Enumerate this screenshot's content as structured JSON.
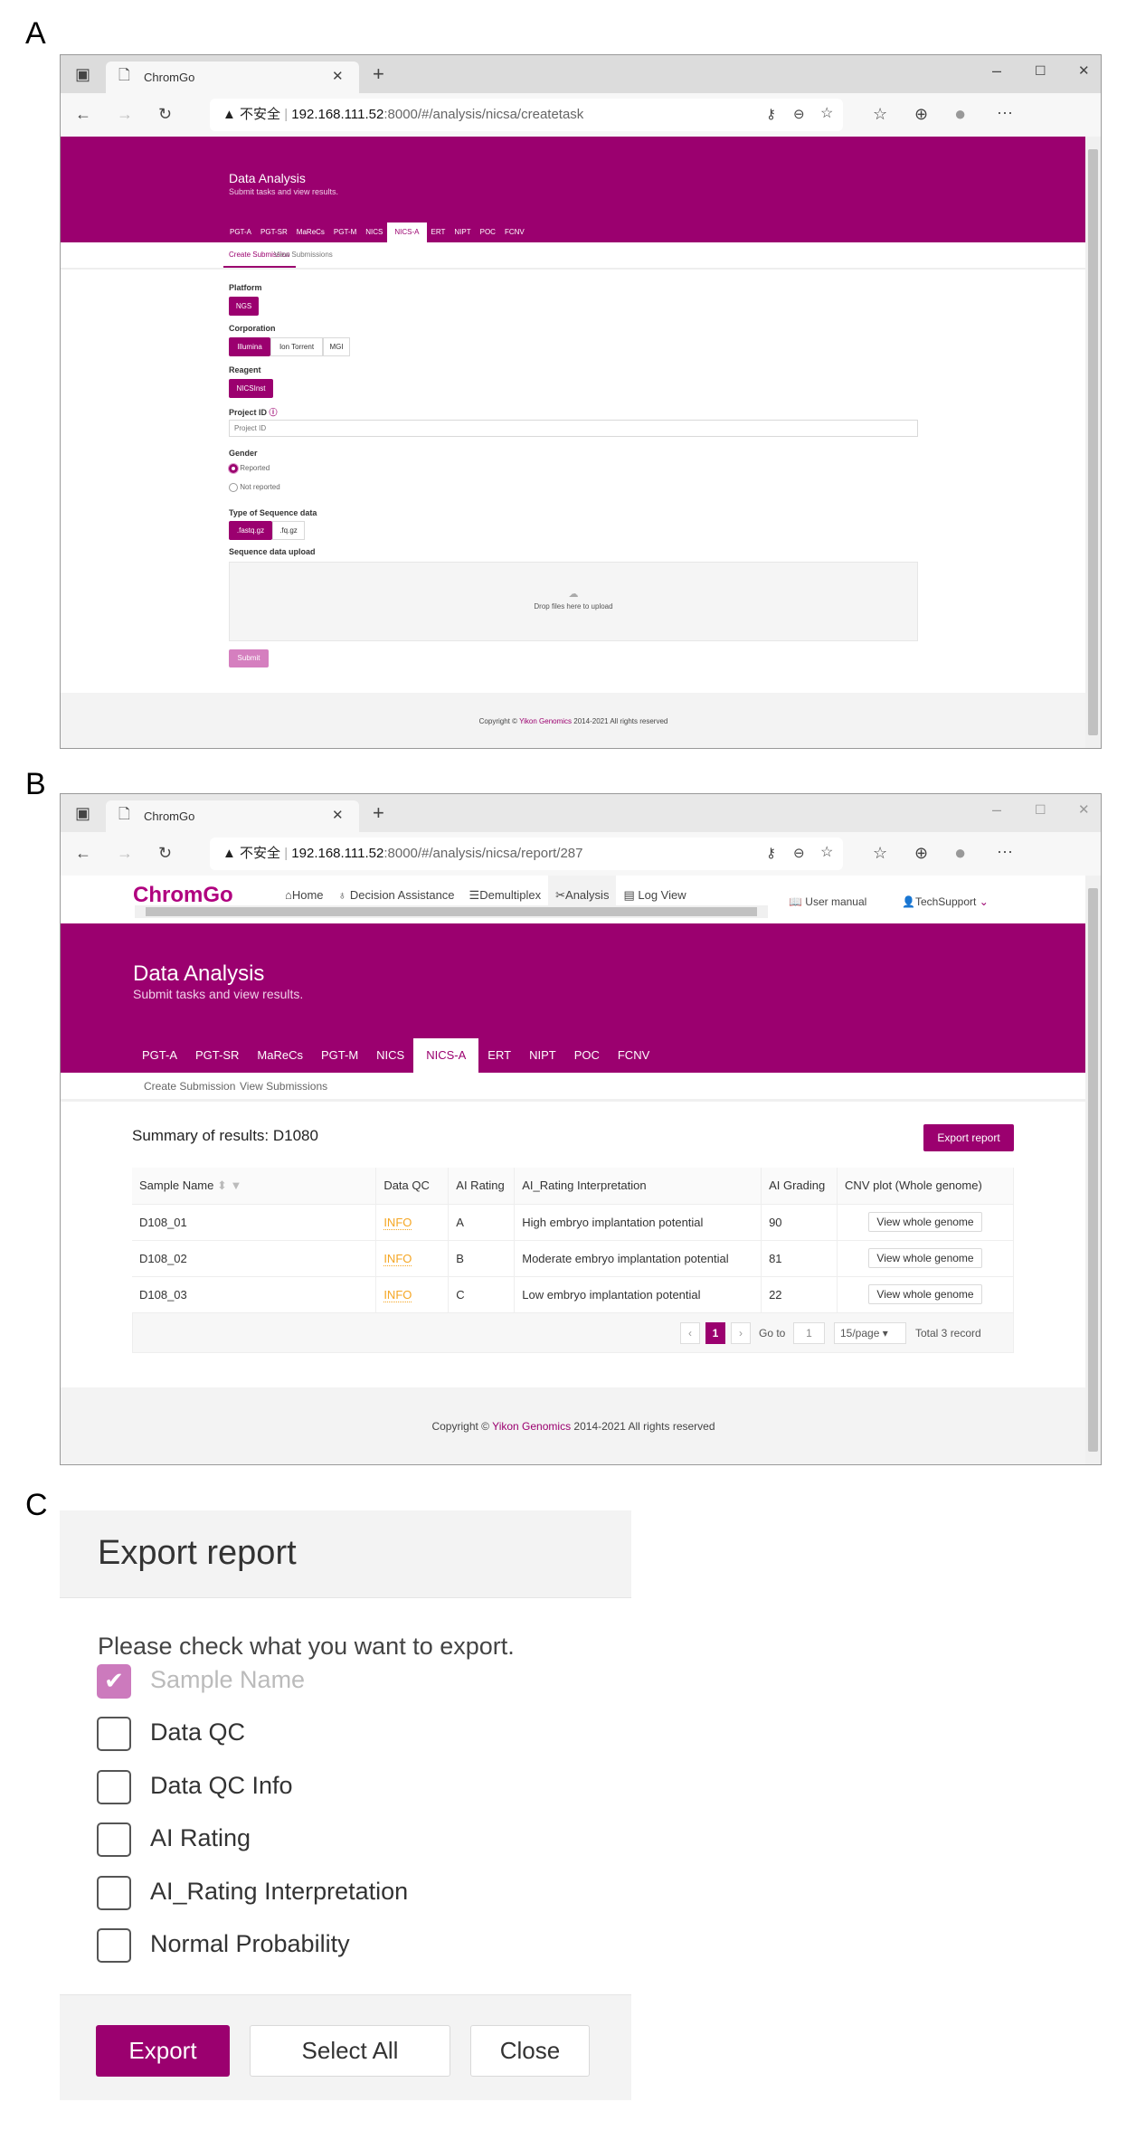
{
  "panel_labels": [
    "A",
    "B",
    "C"
  ],
  "browser": {
    "tab_title": "ChromGo",
    "insecure_label": "不安全",
    "url_a_host": "192.168.111.52",
    "url_a_rest": ":8000/#/analysis/nicsa/createtask",
    "url_b_host": "192.168.111.52",
    "url_b_rest": ":8000/#/analysis/nicsa/report/287"
  },
  "header": {
    "title": "Data Analysis",
    "subtitle": "Submit tasks and view results."
  },
  "tabs": [
    "PGT-A",
    "PGT-SR",
    "MaReCs",
    "PGT-M",
    "NICS",
    "NICS-A",
    "ERT",
    "NIPT",
    "POC",
    "FCNV"
  ],
  "active_tab": "NICS-A",
  "subtabs": [
    "Create Submission",
    "View Submissions"
  ],
  "form": {
    "platform_label": "Platform",
    "platform_options": [
      "NGS"
    ],
    "corporation_label": "Corporation",
    "corporation_options": [
      "Illumina",
      "Ion Torrent",
      "MGI"
    ],
    "reagent_label": "Reagent",
    "reagent_options": [
      "NICSInst"
    ],
    "project_id_label": "Project ID",
    "project_id_placeholder": "Project ID",
    "gender_label": "Gender",
    "gender_options": [
      "Reported",
      "Not reported"
    ],
    "seq_type_label": "Type of Sequence data",
    "seq_type_options": [
      ".fastq.gz",
      ".fq.gz"
    ],
    "upload_label": "Sequence data upload",
    "upload_hint": "Drop files here to upload",
    "submit": "Submit"
  },
  "nav": {
    "logo": "ChromGo",
    "items": [
      "Home",
      "Decision Assistance",
      "Demultiplex",
      "Analysis",
      "Log View"
    ],
    "user_manual": "User manual",
    "user": "TechSupport"
  },
  "report": {
    "summary": "Summary of results: D1080",
    "export_button": "Export report",
    "columns": [
      "Sample Name",
      "Data QC",
      "AI Rating",
      "AI_Rating Interpretation",
      "AI Grading",
      "CNV plot (Whole genome)"
    ],
    "rows": [
      {
        "name": "D108_01",
        "qc": "INFO",
        "rating": "A",
        "interp": "High embryo implantation potential",
        "grading": "90",
        "cnv": "View whole genome"
      },
      {
        "name": "D108_02",
        "qc": "INFO",
        "rating": "B",
        "interp": "Moderate embryo implantation potential",
        "grading": "81",
        "cnv": "View whole genome"
      },
      {
        "name": "D108_03",
        "qc": "INFO",
        "rating": "C",
        "interp": "Low embryo implantation potential",
        "grading": "22",
        "cnv": "View whole genome"
      }
    ],
    "pagination": {
      "page": "1",
      "goto_label": "Go to",
      "goto_value": "1",
      "page_size": "15/page",
      "total": "Total 3 record"
    }
  },
  "footer": {
    "prefix": "Copyright ©",
    "company": "Yikon Genomics",
    "suffix": "2014-2021 All rights reserved"
  },
  "export_dialog": {
    "title": "Export report",
    "prompt": "Please check what you want to export.",
    "options": [
      {
        "label": "Sample Name",
        "checked": true,
        "disabled": true
      },
      {
        "label": "Data QC",
        "checked": false
      },
      {
        "label": "Data QC Info",
        "checked": false
      },
      {
        "label": "AI Rating",
        "checked": false
      },
      {
        "label": "AI_Rating Interpretation",
        "checked": false
      },
      {
        "label": "Normal Probability",
        "checked": false
      }
    ],
    "buttons": [
      "Export",
      "Select All",
      "Close"
    ]
  },
  "colors": {
    "brand": "#9b006f",
    "info": "#f5a623"
  }
}
